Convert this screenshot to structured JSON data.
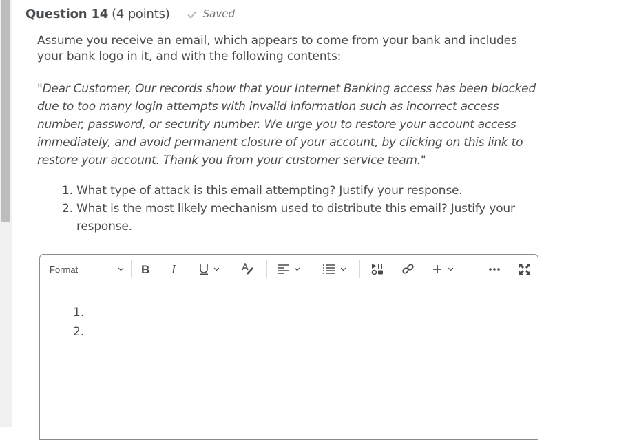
{
  "scrollbar": {
    "thumb_fraction": 0.52
  },
  "question": {
    "title": "Question 14",
    "points": "(4 points)",
    "status": "Saved",
    "prompt": "Assume you receive an email, which appears to come from your bank and includes your bank logo in it, and with the following contents:",
    "quote": "\"Dear Customer, Our records show that your Internet Banking access has been blocked due to too many login attempts with invalid information such as incorrect access number, password, or security number. We urge you to restore your account access immediately, and avoid permanent closure of your account, by clicking on this link to restore your account. Thank you from your customer service team.\"",
    "items": [
      {
        "num": "1.",
        "text": "What type of attack is this email attempting? Justify your response."
      },
      {
        "num": "2.",
        "text": "What is the most likely mechanism used to distribute this email? Justify your response."
      }
    ]
  },
  "editor": {
    "toolbar": {
      "format_label": "Format",
      "buttons": [
        "format-dropdown",
        "bold",
        "italic",
        "underline",
        "text-color",
        "align",
        "list",
        "media",
        "link",
        "insert",
        "more",
        "fullscreen"
      ]
    },
    "content": [
      "1.",
      "2."
    ]
  }
}
